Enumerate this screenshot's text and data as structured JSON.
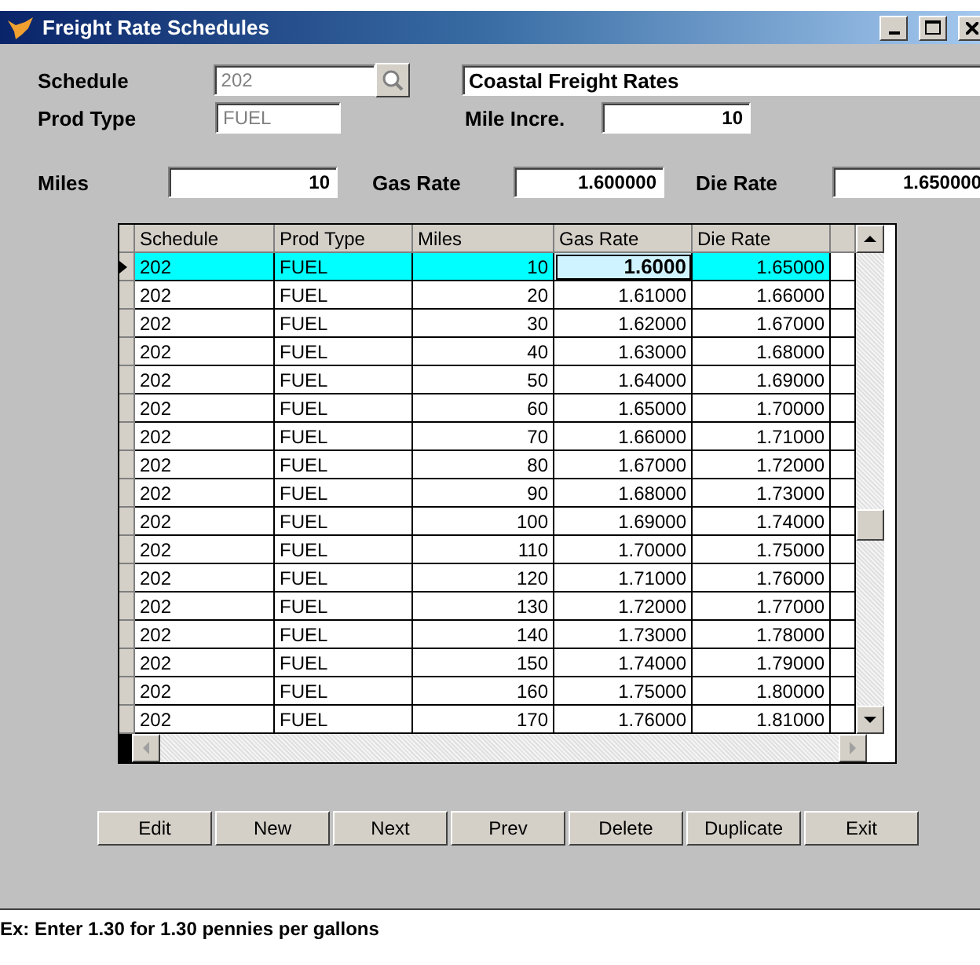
{
  "window": {
    "title": "Freight Rate Schedules"
  },
  "form": {
    "schedule": {
      "label": "Schedule",
      "value": "202",
      "disabled": true
    },
    "description": {
      "value": "Coastal Freight Rates"
    },
    "prod_type": {
      "label": "Prod Type",
      "value": "FUEL",
      "disabled": true
    },
    "mile_incre": {
      "label": "Mile Incre.",
      "value": "10"
    },
    "miles": {
      "label": "Miles",
      "value": "10"
    },
    "gas_rate": {
      "label": "Gas Rate",
      "value": "1.600000"
    },
    "die_rate": {
      "label": "Die Rate",
      "value": "1.650000"
    }
  },
  "table": {
    "columns": [
      "Schedule",
      "Prod Type",
      "Miles",
      "Gas Rate",
      "Die Rate"
    ],
    "rows": [
      {
        "schedule": "202",
        "prod_type": "FUEL",
        "miles": "10",
        "gas_rate": "1.6000",
        "die_rate": "1.65000",
        "selected": true,
        "editing": true
      },
      {
        "schedule": "202",
        "prod_type": "FUEL",
        "miles": "20",
        "gas_rate": "1.61000",
        "die_rate": "1.66000",
        "selected": false,
        "editing": false
      },
      {
        "schedule": "202",
        "prod_type": "FUEL",
        "miles": "30",
        "gas_rate": "1.62000",
        "die_rate": "1.67000",
        "selected": false,
        "editing": false
      },
      {
        "schedule": "202",
        "prod_type": "FUEL",
        "miles": "40",
        "gas_rate": "1.63000",
        "die_rate": "1.68000",
        "selected": false,
        "editing": false
      },
      {
        "schedule": "202",
        "prod_type": "FUEL",
        "miles": "50",
        "gas_rate": "1.64000",
        "die_rate": "1.69000",
        "selected": false,
        "editing": false
      },
      {
        "schedule": "202",
        "prod_type": "FUEL",
        "miles": "60",
        "gas_rate": "1.65000",
        "die_rate": "1.70000",
        "selected": false,
        "editing": false
      },
      {
        "schedule": "202",
        "prod_type": "FUEL",
        "miles": "70",
        "gas_rate": "1.66000",
        "die_rate": "1.71000",
        "selected": false,
        "editing": false
      },
      {
        "schedule": "202",
        "prod_type": "FUEL",
        "miles": "80",
        "gas_rate": "1.67000",
        "die_rate": "1.72000",
        "selected": false,
        "editing": false
      },
      {
        "schedule": "202",
        "prod_type": "FUEL",
        "miles": "90",
        "gas_rate": "1.68000",
        "die_rate": "1.73000",
        "selected": false,
        "editing": false
      },
      {
        "schedule": "202",
        "prod_type": "FUEL",
        "miles": "100",
        "gas_rate": "1.69000",
        "die_rate": "1.74000",
        "selected": false,
        "editing": false
      },
      {
        "schedule": "202",
        "prod_type": "FUEL",
        "miles": "110",
        "gas_rate": "1.70000",
        "die_rate": "1.75000",
        "selected": false,
        "editing": false
      },
      {
        "schedule": "202",
        "prod_type": "FUEL",
        "miles": "120",
        "gas_rate": "1.71000",
        "die_rate": "1.76000",
        "selected": false,
        "editing": false
      },
      {
        "schedule": "202",
        "prod_type": "FUEL",
        "miles": "130",
        "gas_rate": "1.72000",
        "die_rate": "1.77000",
        "selected": false,
        "editing": false
      },
      {
        "schedule": "202",
        "prod_type": "FUEL",
        "miles": "140",
        "gas_rate": "1.73000",
        "die_rate": "1.78000",
        "selected": false,
        "editing": false
      },
      {
        "schedule": "202",
        "prod_type": "FUEL",
        "miles": "150",
        "gas_rate": "1.74000",
        "die_rate": "1.79000",
        "selected": false,
        "editing": false
      },
      {
        "schedule": "202",
        "prod_type": "FUEL",
        "miles": "160",
        "gas_rate": "1.75000",
        "die_rate": "1.80000",
        "selected": false,
        "editing": false
      },
      {
        "schedule": "202",
        "prod_type": "FUEL",
        "miles": "170",
        "gas_rate": "1.76000",
        "die_rate": "1.81000",
        "selected": false,
        "editing": false
      }
    ]
  },
  "buttons": [
    {
      "label": "Edit"
    },
    {
      "label": "New"
    },
    {
      "label": "Next"
    },
    {
      "label": "Prev"
    },
    {
      "label": "Delete"
    },
    {
      "label": "Duplicate"
    },
    {
      "label": "Exit"
    }
  ],
  "status_bar": {
    "text": "Ex:  Enter 1.30 for  1.30 pennies per gallons"
  }
}
